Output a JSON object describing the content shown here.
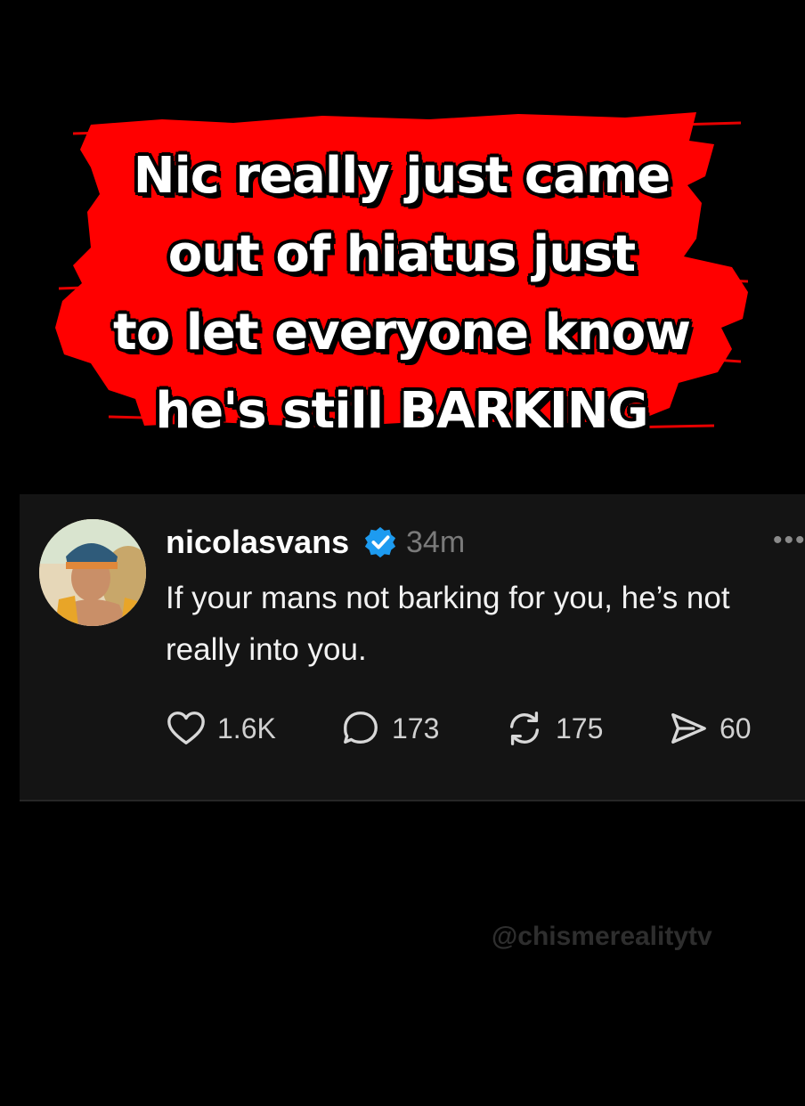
{
  "banner": {
    "lines": [
      "Nic really just came",
      "out of hiatus just",
      "to let everyone know",
      "he's still BARKING"
    ],
    "background_color": "#ff0000"
  },
  "post": {
    "username": "nicolasvans",
    "verified": true,
    "verified_color": "#1d9bf0",
    "timestamp": "34m",
    "more_icon": "more-horizontal-icon",
    "text": "If your mans not barking for you, he’s not\nreally into you.",
    "actions": {
      "likes": {
        "icon": "heart-icon",
        "count": "1.6K"
      },
      "replies": {
        "icon": "comment-icon",
        "count": "173"
      },
      "reposts": {
        "icon": "repost-icon",
        "count": "175"
      },
      "shares": {
        "icon": "send-icon",
        "count": "60"
      }
    }
  },
  "watermark": {
    "text": "@chismerealitytv"
  }
}
